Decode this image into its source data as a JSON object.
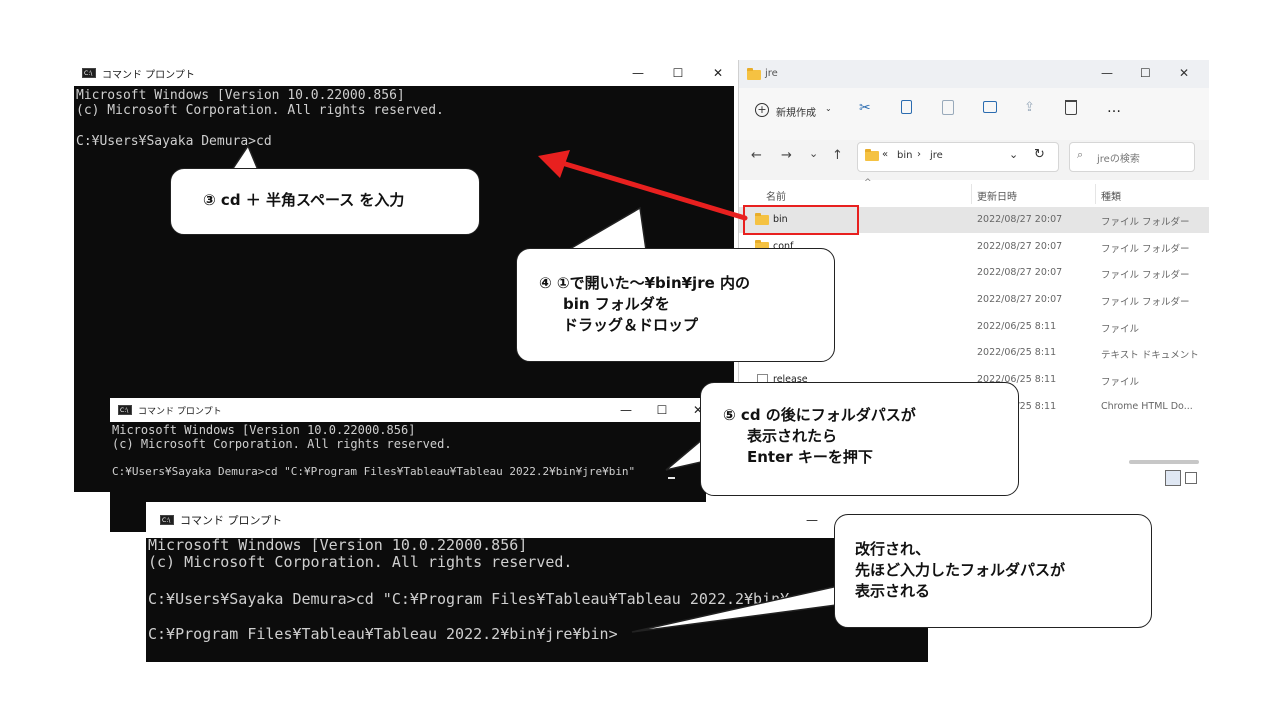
{
  "cmd": {
    "title": "コマンド プロンプト",
    "minimize": "—",
    "maximize": "☐",
    "close": "✕",
    "header_line1": "Microsoft Windows [Version 10.0.22000.856]",
    "header_line2": "(c) Microsoft Corporation. All rights reserved.",
    "win1_prompt": "C:¥Users¥Sayaka Demura>cd",
    "win2_prompt": "C:¥Users¥Sayaka Demura>cd \"C:¥Program Files¥Tableau¥Tableau 2022.2¥bin¥jre¥bin\"",
    "win3_prompt1": "C:¥Users¥Sayaka Demura>cd \"C:¥Program Files¥Tableau¥Tableau 2022.2¥bin¥",
    "win3_prompt2": "C:¥Program Files¥Tableau¥Tableau 2022.2¥bin¥jre¥bin>"
  },
  "explorer": {
    "title": "jre",
    "new_button": "新規作成",
    "more_button": "…",
    "nav_back": "←",
    "nav_forward": "→",
    "nav_dropdown": "⌄",
    "nav_up": "↑",
    "address_prefix": "«",
    "address_bin": "bin",
    "address_sep": "›",
    "address_jre": "jre",
    "address_dropdown": "⌄",
    "refresh": "↻",
    "search_placeholder": "jreの検索",
    "col_name": "名前",
    "col_date": "更新日時",
    "col_type": "種類",
    "sort_indicator": "^",
    "rows": [
      {
        "name": "bin",
        "date": "2022/08/27 20:07",
        "type": "ファイル フォルダー"
      },
      {
        "name": "conf",
        "date": "2022/08/27 20:07",
        "type": "ファイル フォルダー"
      },
      {
        "name": "",
        "date": "2022/08/27 20:07",
        "type": "ファイル フォルダー"
      },
      {
        "name": "",
        "date": "2022/08/27 20:07",
        "type": "ファイル フォルダー"
      },
      {
        "name": "",
        "date": "2022/06/25 8:11",
        "type": "ファイル"
      },
      {
        "name": "",
        "date": "2022/06/25 8:11",
        "type": "テキスト ドキュメント"
      },
      {
        "name": "release",
        "date": "2022/06/25 8:11",
        "type": "ファイル"
      },
      {
        "name": "",
        "date": "2022/06/25 8:11",
        "type": "Chrome HTML Do..."
      }
    ]
  },
  "callouts": {
    "c3": "③ cd ＋ 半角スペース を入力",
    "c4_line1": "④ ①で開いた～¥bin¥jre 内の",
    "c4_line2": "bin フォルダを",
    "c4_line3": "ドラッグ＆ドロップ",
    "c5_line1": "⑤ cd の後にフォルダパスが",
    "c5_line2": "表示されたら",
    "c5_line3": "Enter キーを押下",
    "c6_line1": "改行され、",
    "c6_line2": "先ほど入力したフォルダパスが",
    "c6_line3": "表示される"
  },
  "colors": {
    "console_bg": "#0c0c0c",
    "console_text": "#cfcfcf",
    "arrow": "#e8201f",
    "highlight_box": "#e8201f",
    "folder": "#f5c242"
  }
}
